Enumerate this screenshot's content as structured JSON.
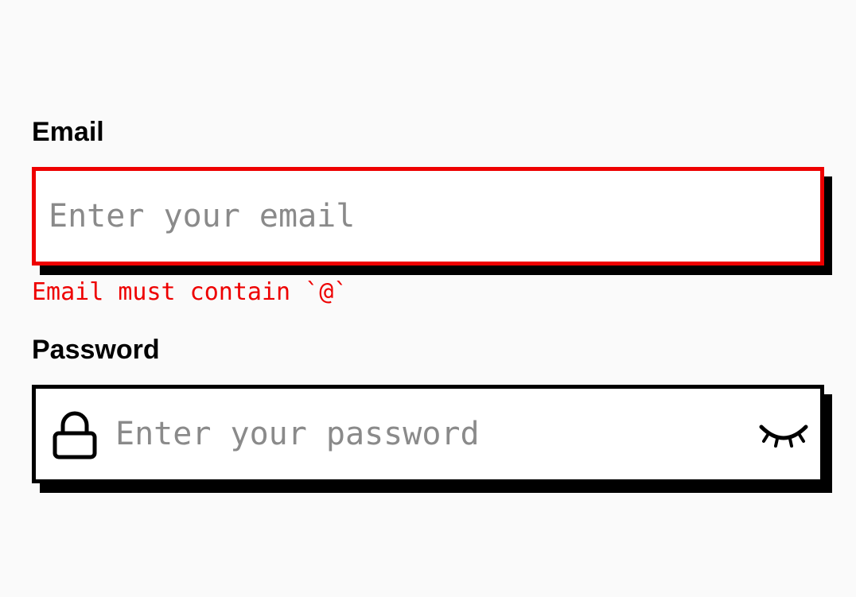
{
  "form": {
    "email": {
      "label": "Email",
      "placeholder": "Enter your email",
      "value": "",
      "error": "Email must contain `@`"
    },
    "password": {
      "label": "Password",
      "placeholder": "Enter your password",
      "value": "",
      "leading_icon": "lock-icon",
      "trailing_icon": "eye-closed-icon"
    }
  },
  "colors": {
    "background": "#fafafa",
    "error": "#ee0000",
    "border": "#000000",
    "placeholder": "#8a8a8a"
  }
}
